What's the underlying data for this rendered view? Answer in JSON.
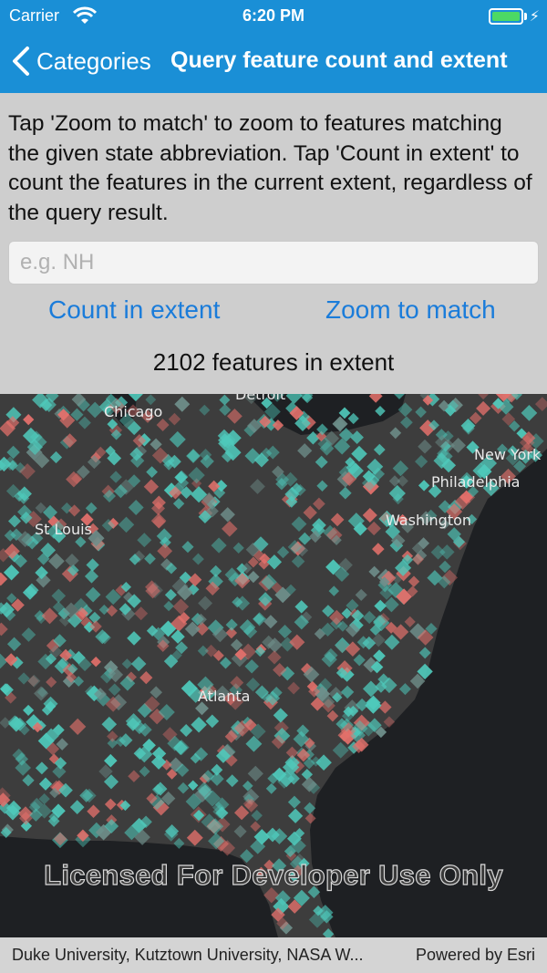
{
  "status_bar": {
    "carrier": "Carrier",
    "time": "6:20 PM",
    "battery_level": 1.0
  },
  "nav": {
    "back_label": "Categories",
    "title": "Query feature count and extent"
  },
  "panel": {
    "instructions": "Tap 'Zoom to match' to zoom to features matching the given state abbreviation. Tap 'Count in extent' to count the features in the current extent, regardless of the query result.",
    "search": {
      "placeholder": "e.g. NH",
      "value": ""
    },
    "count_button": "Count in extent",
    "zoom_button": "Zoom to match",
    "result": "2102 features in extent"
  },
  "map": {
    "cities": [
      "Detroit",
      "Chicago",
      "New York",
      "Philadelphia",
      "St Louis",
      "Washington",
      "Atlanta"
    ],
    "watermark": "Licensed For Developer Use Only",
    "colors": {
      "water": "#1e2023",
      "land": "#3d3d3d",
      "feature_teal": "#4fc9bb",
      "feature_red": "#e3706b"
    }
  },
  "attribution": {
    "text": "Duke University, Kutztown University, NASA W...",
    "powered_by": "Powered by Esri"
  }
}
